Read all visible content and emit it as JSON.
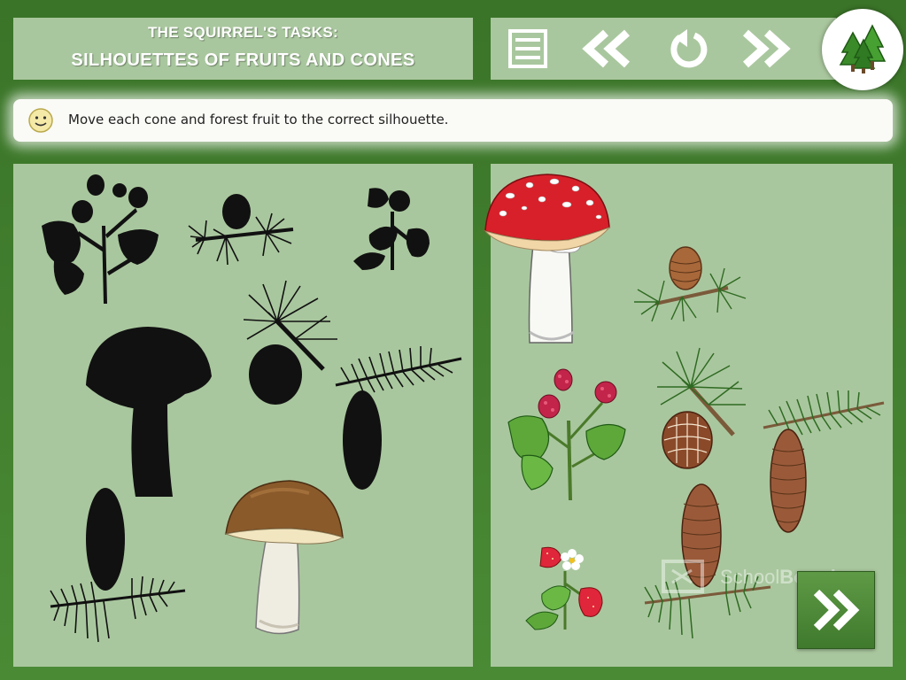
{
  "header": {
    "line1": "THE SQUIRREL'S TASKS:",
    "line2": "SILHOUETTES OF FRUITS AND CONES"
  },
  "toolbar": {
    "menu_icon": "menu-icon",
    "back_icon": "double-chevron-left-icon",
    "restart_icon": "restart-icon",
    "forward_icon": "double-chevron-right-icon"
  },
  "logo_icon": "forest-trees-icon",
  "instruction": {
    "icon": "smiley-icon",
    "text": "Move each cone and forest fruit to the correct silhouette."
  },
  "watermark": {
    "part1": "School",
    "part2": "Board"
  },
  "next_icon": "next-arrow-icon",
  "colors": {
    "frame_green": "#3f7a2d",
    "panel_green": "#a9c79e",
    "silhouette": "#111111",
    "text_white": "#ffffff"
  }
}
